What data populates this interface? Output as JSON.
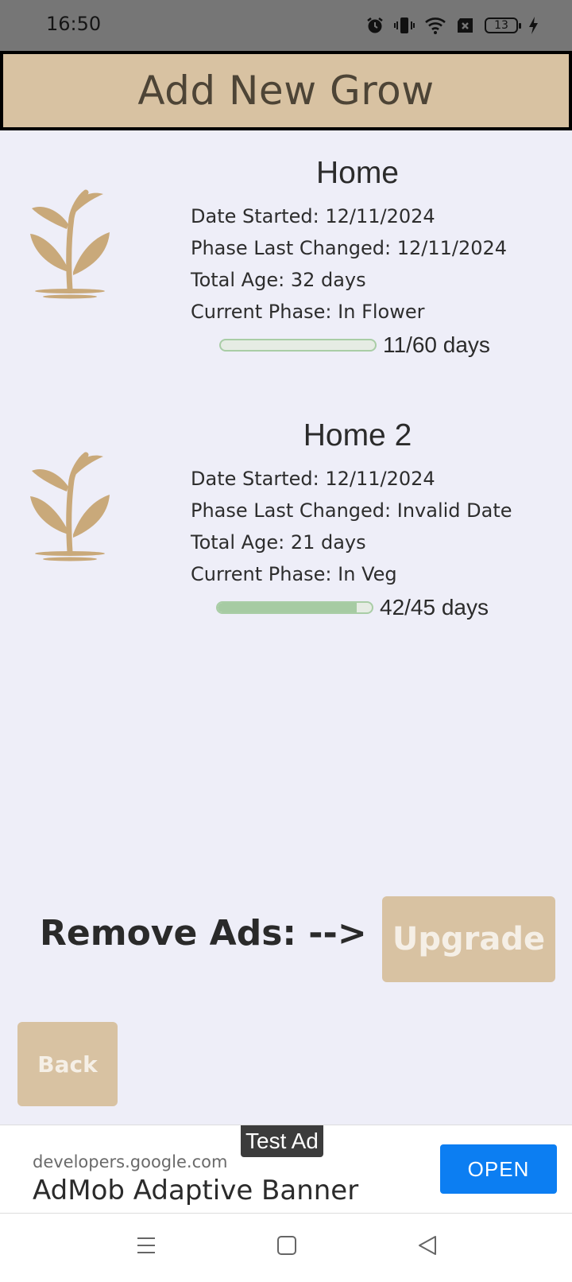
{
  "status_bar": {
    "time": "16:50",
    "battery_level": "13",
    "icons": [
      "alarm-icon",
      "vibrate-icon",
      "wifi-icon",
      "sim-blocked-icon",
      "battery-icon",
      "charging-icon"
    ]
  },
  "header": {
    "title": "Add New Grow"
  },
  "grows": [
    {
      "name": "Home",
      "date_started": "Date Started:  12/11/2024",
      "phase_last_changed": "Phase Last Changed:  12/11/2024",
      "total_age": "Total Age:  32 days",
      "current_phase": "Current Phase: In Flower",
      "progress_label": "11/60 days",
      "progress_fraction": 0.0
    },
    {
      "name": "Home 2",
      "date_started": "Date Started:  12/11/2024",
      "phase_last_changed": "Phase Last Changed:  Invalid Date",
      "total_age": "Total Age:  21 days",
      "current_phase": "Current Phase: In Veg",
      "progress_label": "42/45 days",
      "progress_fraction": 0.9
    }
  ],
  "upsell": {
    "remove_ads_label": "Remove Ads: -->",
    "upgrade_label": "Upgrade"
  },
  "back_label": "Back",
  "ad": {
    "badge": "Test Ad",
    "domain": "developers.google.com",
    "title": "AdMob Adaptive Banner",
    "cta": "OPEN"
  },
  "colors": {
    "accent": "#d8c2a2",
    "background": "#eeeef8",
    "progress": "#a6cba3",
    "ad_button": "#0c7ef2"
  }
}
